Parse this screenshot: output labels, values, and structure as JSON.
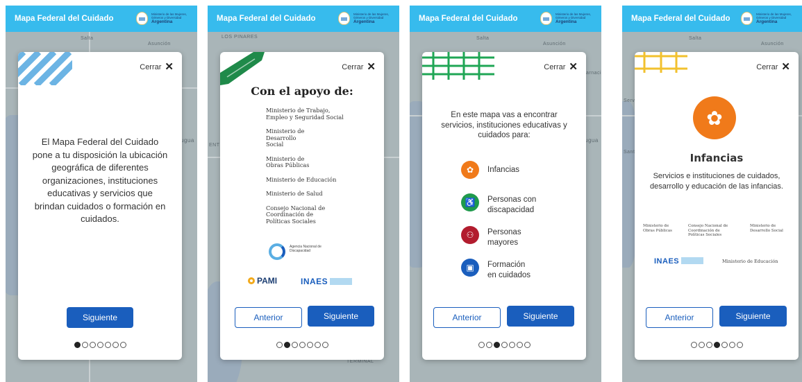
{
  "app": {
    "title": "Mapa Federal del Cuidado",
    "logo_text": "Ministerio de las Mujeres, Géneros y Diversidad",
    "logo_country": "Argentina"
  },
  "common": {
    "close_label": "Cerrar",
    "next_label": "Siguiente",
    "prev_label": "Anterior"
  },
  "map_labels": {
    "salta": "Salta",
    "asuncion": "Asunción",
    "los_pinares": "LOS PINARES",
    "entre": "ENTR",
    "terminal": "TERMINAL",
    "uguay": "ugua",
    "arnaci": "arnaci",
    "serv": "Serv",
    "sant": "Sant"
  },
  "screens": [
    {
      "intro_text": "El Mapa Federal del Cuidado pone a tu disposición la ubicación geográfica de diferentes organizaciones, instituciones educativas y servicios que brindan cuidados o formación en cuidados.",
      "active_dot": 0
    },
    {
      "heading": "Con el apoyo de:",
      "sponsors": [
        "Ministerio de Trabajo, Empleo y Seguridad Social",
        "Ministerio de Desarrollo Social",
        "Ministerio de Obras Públicas",
        "Ministerio de Educación",
        "Ministerio de Salud",
        "Consejo Nacional de Coordinación de Políticas Sociales"
      ],
      "agency_text": "Agencia Nacional de Discapacidad",
      "pami": "PAMI",
      "inaes": "INAES",
      "active_dot": 1
    },
    {
      "intro_text": "En este mapa vas a encontrar servicios, instituciones educativas y cuidados para:",
      "categories": [
        {
          "label": "Infancias",
          "color": "#f07a1a",
          "icon": "puzzle-icon"
        },
        {
          "label": "Personas con discapacidad",
          "color": "#1f9a4c",
          "icon": "wheelchair-icon"
        },
        {
          "label": "Personas mayores",
          "color": "#b21c2e",
          "icon": "elderly-icon"
        },
        {
          "label": "Formación en cuidados",
          "color": "#1a5ebd",
          "icon": "book-icon"
        }
      ],
      "active_dot": 2
    },
    {
      "heading": "Infancias",
      "description": "Servicios e instituciones de cuidados, desarrollo y educación de las infancias.",
      "orgs": [
        "Ministerio de Obras Públicas",
        "Consejo Nacional de Coordinación de Políticas Sociales",
        "Ministerio de Desarrollo Social"
      ],
      "inaes": "INAES",
      "education": "Ministerio de Educación",
      "active_dot": 3
    }
  ],
  "dots_total": 7,
  "colors": {
    "topbar": "#37bbed",
    "primary": "#1a5ebd",
    "infancias": "#f07a1a"
  }
}
